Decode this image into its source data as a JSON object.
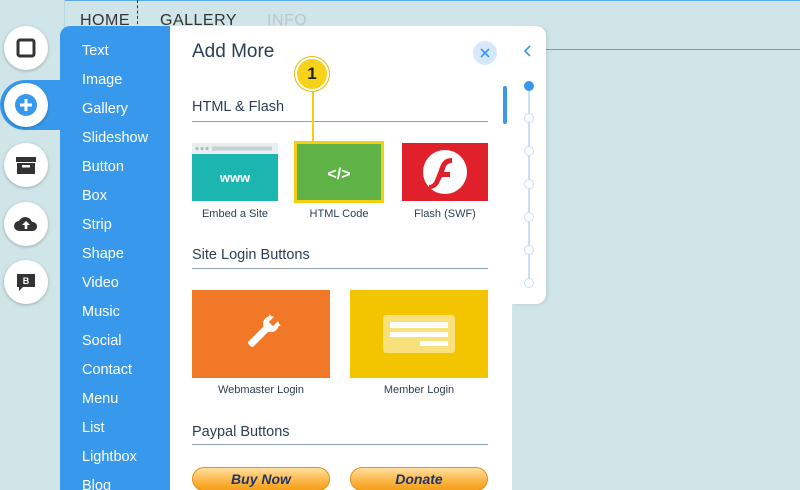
{
  "site_nav": [
    "HOME",
    "GALLERY",
    "INFO"
  ],
  "left_toolbar": [
    {
      "icon": "background-icon"
    },
    {
      "icon": "add-icon"
    },
    {
      "icon": "store-icon"
    },
    {
      "icon": "upload-icon"
    },
    {
      "icon": "blog-icon"
    }
  ],
  "categories": [
    "Text",
    "Image",
    "Gallery",
    "Slideshow",
    "Button",
    "Box",
    "Strip",
    "Shape",
    "Video",
    "Music",
    "Social",
    "Contact",
    "Menu",
    "List",
    "Lightbox",
    "Blog"
  ],
  "panel": {
    "title": "Add More",
    "sections": {
      "html_flash": {
        "title": "HTML & Flash",
        "items": [
          {
            "label": "Embed a Site",
            "graphic_text": "www"
          },
          {
            "label": "HTML Code",
            "graphic_text": "</>"
          },
          {
            "label": "Flash (SWF)"
          }
        ]
      },
      "site_login": {
        "title": "Site Login Buttons",
        "items": [
          {
            "label": "Webmaster Login"
          },
          {
            "label": "Member Login"
          }
        ]
      },
      "paypal": {
        "title": "Paypal Buttons",
        "items": [
          {
            "label": "Buy Now"
          },
          {
            "label": "Donate"
          }
        ]
      }
    }
  },
  "callout": {
    "number": "1"
  },
  "colors": {
    "accent": "#3899ec",
    "embed_tile": "#1cb5b0",
    "html_tile": "#5fb346",
    "flash_tile": "#e0212b",
    "webmaster_tile": "#f17827",
    "member_tile": "#f2c500",
    "callout": "#f7d21a"
  }
}
